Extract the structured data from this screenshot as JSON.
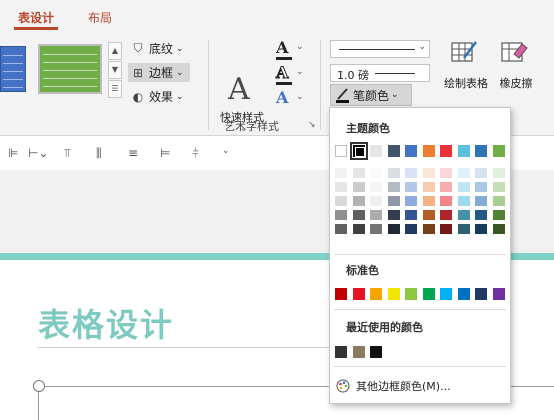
{
  "tabs": [
    {
      "label": "表设计",
      "active": true
    },
    {
      "label": "布局",
      "active": false
    }
  ],
  "table_styles": {
    "border_label": "边框",
    "shading_label": "底纹",
    "effects_label": "效果"
  },
  "wordart": {
    "quick_styles_label": "快速样式",
    "group_label": "艺术字样式"
  },
  "draw_borders": {
    "weight_value": "1.0 磅",
    "pen_color_label": "笔颜色",
    "draw_table_label": "绘制表格",
    "eraser_label": "橡皮擦"
  },
  "slide": {
    "title": "表格设计"
  },
  "color_menu": {
    "theme_heading": "主题颜色",
    "theme_colors": [
      "#ffffff",
      "#000000",
      "#e7e6e6",
      "#44546a",
      "#4472c4",
      "#ed7d31",
      "#e8333a",
      "#5bc0de",
      "#2e75b6",
      "#70ad47"
    ],
    "selected_index": 1,
    "standard_heading": "标准色",
    "standard_colors": [
      "#c00000",
      "#e81123",
      "#f7a600",
      "#f2e500",
      "#8dc63f",
      "#00a651",
      "#00b0f0",
      "#0070c0",
      "#1f3864",
      "#7030a0"
    ],
    "recent_heading": "最近使用的颜色",
    "recent_colors": [
      "#333333",
      "#8b7b5e",
      "#111111"
    ],
    "more_label": "其他边框颜色(M)..."
  },
  "colors": {
    "accent": "#b7472a",
    "teal": "#7fd2c8"
  }
}
